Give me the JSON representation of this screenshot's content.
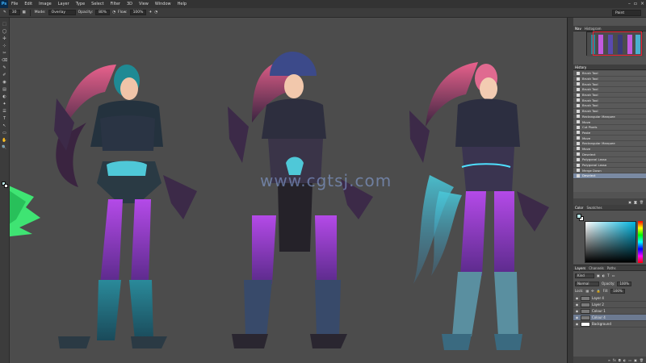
{
  "app": {
    "logo": "Ps"
  },
  "menu": [
    "File",
    "Edit",
    "Image",
    "Layer",
    "Type",
    "Select",
    "Filter",
    "3D",
    "View",
    "Window",
    "Help"
  ],
  "window_controls": [
    "–",
    "▫",
    "×"
  ],
  "options": {
    "brush_size": "30",
    "mode_label": "Mode:",
    "mode_value": "Overlay",
    "opacity_label": "Opacity:",
    "opacity_value": "80%",
    "flow_label": "Flow:",
    "flow_value": "100%"
  },
  "workspace": "Paint",
  "tools": [
    "⬚",
    "◯",
    "✣",
    "⊹",
    "✂",
    "⌫",
    "✎",
    "✐",
    "◉",
    "▤",
    "◐",
    "✦",
    "☰",
    "T",
    "↖",
    "▭",
    "✋",
    "🔍"
  ],
  "navigator": {
    "tabs": [
      "Nav",
      "Histogram"
    ]
  },
  "history": {
    "tab": "History",
    "rows": [
      "Brush Tool",
      "Brush Tool",
      "Brush Tool",
      "Brush Tool",
      "Brush Tool",
      "Brush Tool",
      "Brush Tool",
      "Brush Tool",
      "Rectangular Marquee",
      "Move",
      "Cut Pixels",
      "Paste",
      "Move",
      "Rectangular Marquee",
      "Move",
      "Deselect",
      "Polygonal Lasso",
      "Polygonal Lasso",
      "Merge Down",
      "Deselect"
    ],
    "active_index": 19
  },
  "color_panel": {
    "tabs": [
      "Color",
      "Swatches"
    ],
    "foreground": "#b7e6e6",
    "background": "#ffffff"
  },
  "layers": {
    "tabs": [
      "Layers",
      "Channels",
      "Paths"
    ],
    "kind": "Kind",
    "blend": "Normal",
    "opacity_label": "Opacity:",
    "opacity_value": "100%",
    "lock_label": "Lock:",
    "fill_label": "Fill:",
    "fill_value": "100%",
    "rows": [
      {
        "name": "Layer 4",
        "active": false
      },
      {
        "name": "Layer 2",
        "active": false
      },
      {
        "name": "Colour 1",
        "active": false
      },
      {
        "name": "Colour 4",
        "active": true
      },
      {
        "name": "Background",
        "active": false
      }
    ]
  },
  "watermark": "www.cgtsj.com",
  "icon_names": [
    "ps-logo",
    "brush-icon",
    "eye-icon",
    "trash-icon",
    "new-layer-icon"
  ]
}
